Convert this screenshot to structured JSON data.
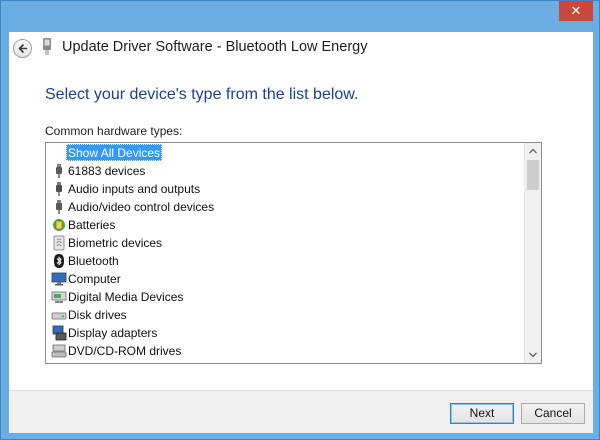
{
  "window": {
    "title": "Update Driver Software - Bluetooth Low Energy",
    "close_glyph": "✕"
  },
  "main": {
    "heading": "Select your device's type from the list below.",
    "list_label": "Common hardware types:",
    "items": [
      {
        "label": "Show All Devices",
        "icon": "none",
        "selected": true
      },
      {
        "label": "61883 devices",
        "icon": "plug-icon"
      },
      {
        "label": "Audio inputs and outputs",
        "icon": "speaker-icon"
      },
      {
        "label": "Audio/video control devices",
        "icon": "plug-icon"
      },
      {
        "label": "Batteries",
        "icon": "battery-icon"
      },
      {
        "label": "Biometric devices",
        "icon": "fingerprint-icon"
      },
      {
        "label": "Bluetooth",
        "icon": "bluetooth-icon"
      },
      {
        "label": "Computer",
        "icon": "monitor-icon"
      },
      {
        "label": "Digital Media Devices",
        "icon": "media-device-icon"
      },
      {
        "label": "Disk drives",
        "icon": "disk-drive-icon"
      },
      {
        "label": "Display adapters",
        "icon": "display-adapter-icon"
      },
      {
        "label": "DVD/CD-ROM drives",
        "icon": "optical-drive-icon"
      }
    ]
  },
  "footer": {
    "next_label": "Next",
    "cancel_label": "Cancel"
  },
  "colors": {
    "window_frame": "#6aaee4",
    "heading": "#1f3f91",
    "selection": "#3399ff",
    "close_button": "#c7483c"
  }
}
